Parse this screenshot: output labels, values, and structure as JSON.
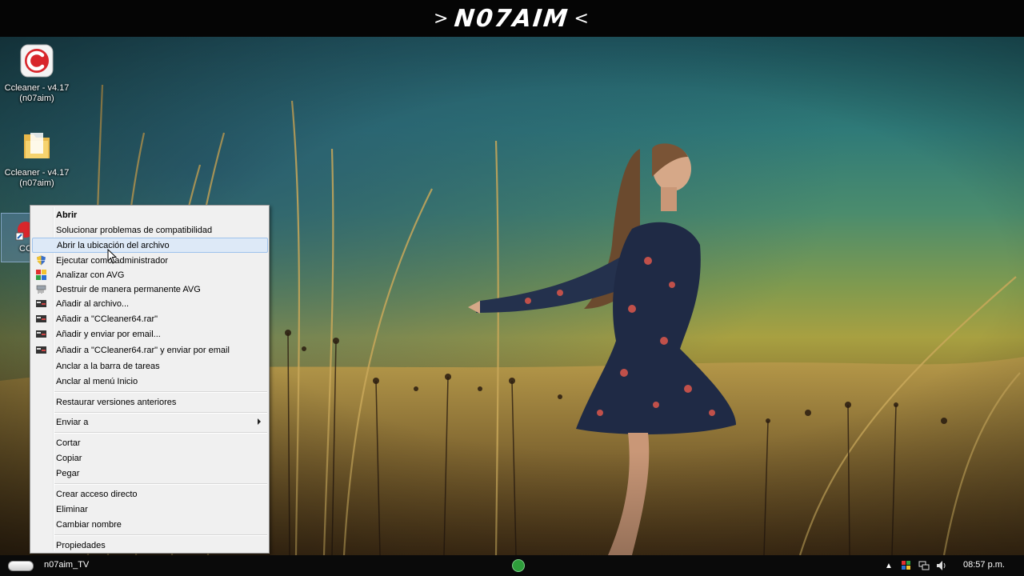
{
  "banner": {
    "left_arrow": ">",
    "title": "N07AIM",
    "right_arrow": "<"
  },
  "desktop": {
    "icons": [
      {
        "label_line1": "Ccleaner - v4.17",
        "label_line2": "(n07aim)",
        "icon": "ccleaner-icon"
      },
      {
        "label_line1": "Ccleaner - v4.17",
        "label_line2": "(n07aim)",
        "icon": "folder-icon"
      },
      {
        "label_line1": "CC",
        "icon": "shortcut-icon"
      }
    ]
  },
  "context_menu": {
    "items": [
      {
        "label": "Abrir",
        "bold": true,
        "icon": ""
      },
      {
        "label": "Solucionar problemas de compatibilidad",
        "icon": ""
      },
      {
        "label": "Abrir la ubicación del archivo",
        "icon": "",
        "highlighted": true
      },
      {
        "label": "Ejecutar como administrador",
        "icon": "shield-icon"
      },
      {
        "label": "Analizar con AVG",
        "icon": "avg-icon"
      },
      {
        "label": "Destruir de manera permanente AVG",
        "icon": "shredder-icon"
      },
      {
        "label": "Añadir al archivo...",
        "icon": "winrar-icon"
      },
      {
        "label": "Añadir a \"CCleaner64.rar\"",
        "icon": "winrar-icon"
      },
      {
        "label": "Añadir y enviar por email...",
        "icon": "winrar-icon"
      },
      {
        "label": "Añadir a \"CCleaner64.rar\" y enviar por email",
        "icon": "winrar-icon"
      },
      {
        "label": "Anclar a la barra de tareas",
        "icon": ""
      },
      {
        "label": "Anclar al menú Inicio",
        "icon": ""
      },
      {
        "label": "Restaurar versiones anteriores",
        "icon": ""
      },
      {
        "label": "Enviar a",
        "icon": "",
        "submenu": true
      },
      {
        "label": "Cortar",
        "icon": ""
      },
      {
        "label": "Copiar",
        "icon": ""
      },
      {
        "label": "Pegar",
        "icon": ""
      },
      {
        "label": "Crear acceso directo",
        "icon": ""
      },
      {
        "label": "Eliminar",
        "icon": ""
      },
      {
        "label": "Cambiar nombre",
        "icon": ""
      },
      {
        "label": "Propiedades",
        "icon": ""
      }
    ]
  },
  "taskbar": {
    "label": "n07aim_TV",
    "clock": "08:57 p.m.",
    "tray_icons": [
      "tray-up-arrow-icon",
      "flag-icon",
      "network-icon",
      "volume-icon"
    ]
  },
  "colors": {
    "menu_bg": "#f0f0f0",
    "menu_highlight": "#dde9f7",
    "menu_highlight_border": "#9fc3ec",
    "taskbar_bg": "#0a0a0a"
  }
}
